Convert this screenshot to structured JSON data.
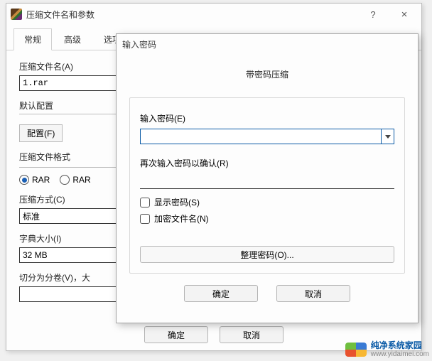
{
  "parent": {
    "title": "压缩文件名和参数",
    "help_glyph": "?",
    "close_glyph": "×",
    "tabs": [
      "常规",
      "高级",
      "选项"
    ],
    "active_tab_index": 0,
    "filename_label": "压缩文件名(A)",
    "filename_value": "1.rar",
    "default_config_label": "默认配置",
    "config_button": "配置(F)",
    "format_label": "压缩文件格式",
    "format_options": {
      "rar": "RAR",
      "rar4": "RAR"
    },
    "method_label": "压缩方式(C)",
    "method_value": "标准",
    "dict_label": "字典大小(I)",
    "dict_value": "32 MB",
    "split_label": "切分为分卷(V)，大",
    "ok": "确定",
    "cancel": "取消"
  },
  "child": {
    "title": "输入密码",
    "heading": "带密码压缩",
    "enter_label": "输入密码(E)",
    "confirm_label": "再次输入密码以确认(R)",
    "password_value": "",
    "confirm_value": "",
    "show_password": "显示密码(S)",
    "encrypt_names": "加密文件名(N)",
    "organize": "整理密码(O)...",
    "ok": "确定",
    "cancel": "取消"
  },
  "watermark": {
    "name": "纯净系统家园",
    "url": "www.yidaimei.com"
  }
}
